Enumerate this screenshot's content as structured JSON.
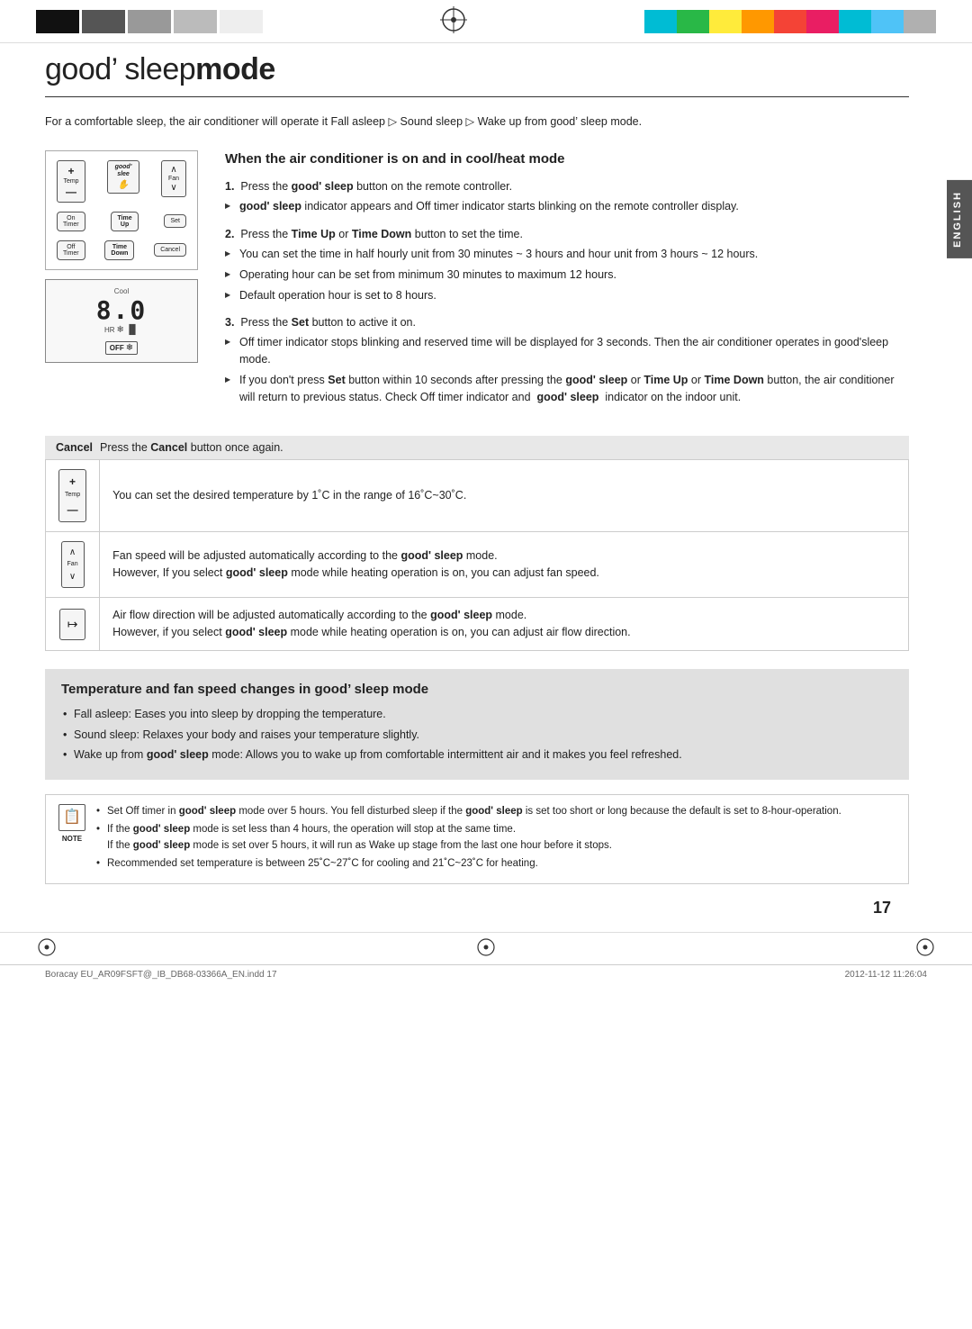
{
  "page": {
    "number": "17",
    "title_prefix": "good’ sleep",
    "title_suffix": "mode"
  },
  "top_bar": {
    "blocks": [
      "#222222",
      "#666666",
      "#999999",
      "#cccccc",
      "#ffffff"
    ],
    "color_swatches": [
      "#00bcd4",
      "#4caf50",
      "#ffeb3b",
      "#ff9800",
      "#f44336",
      "#e91e63",
      "#9c27b0",
      "#2196f3",
      "#00bcd4",
      "#aaaaaa"
    ]
  },
  "intro": "For a comfortable sleep, the air conditioner will operate it Fall asleep ▷ Sound sleep ▷ Wake up from good’ sleep mode.",
  "when_section": {
    "title": "When the air conditioner is on and in cool/heat mode",
    "steps": [
      {
        "number": "1",
        "heading": "Press the good’ sleep button on the remote controller.",
        "bullets": [
          "good’ sleep indicator appears and Off timer indicator starts blinking on the remote controller display."
        ]
      },
      {
        "number": "2",
        "heading": "Press the Time Up or Time Down button to set the time.",
        "bullets": [
          "You can set the time in half hourly unit from 30 minutes ~ 3 hours and hour unit from 3 hours ~ 12 hours.",
          "Operating hour can be set from minimum 30 minutes to maximum 12 hours.",
          "Default operation hour is set to 8 hours."
        ]
      },
      {
        "number": "3",
        "heading": "Press the Set button to active it on.",
        "bullets": [
          "Off timer indicator stops blinking and reserved time will be displayed for 3 seconds. Then the air conditioner operates in good’sleep mode.",
          "If you don’t press Set button within 10 seconds after pressing the good’ sleep or Time Up or Time Down button, the air conditioner will return to previous status. Check Off timer indicator and  good’ sleep  indicator on the indoor unit."
        ]
      }
    ]
  },
  "cancel_box": {
    "label": "Cancel",
    "text": "Press the Cancel button once again."
  },
  "info_table": [
    {
      "icon": "temp-icon",
      "icon_label": "+\nTemp\n—",
      "text": "You can set the desired temperature by 1˚C in the range of 16˚C~30˚C."
    },
    {
      "icon": "fan-icon",
      "icon_label": "∧\nFan\n∨",
      "text": "Fan speed will be adjusted automatically according to the good’ sleep mode.\nHowever, If you select good’ sleep mode while heating operation is on, you can adjust fan speed."
    },
    {
      "icon": "airflow-icon",
      "icon_label": "↦",
      "text": "Air flow direction will be adjusted automatically according to the good’ sleep mode.\nHowever, if you select good’ sleep mode while heating operation is on, you can adjust air flow direction."
    }
  ],
  "temperature_section": {
    "title": "Temperature and fan speed changes in good’ sleep mode",
    "bullets": [
      "Fall asleep: Eases you into sleep by dropping the temperature.",
      "Sound sleep: Relaxes your body and raises your temperature slightly.",
      "Wake up from good’ sleep mode: Allows you to wake up from comfortable intermittent air and it makes you feel refreshed."
    ]
  },
  "note_section": {
    "note_label": "NOTE",
    "bullets": [
      "Set Off timer in good’ sleep mode over 5 hours. You fell disturbed sleep if the good’ sleep is set too short or long because the default is set to 8-hour-operation.",
      "If the good’ sleep mode is set less than 4 hours, the operation will stop at the same time.\nIf the good’ sleep mode is set over 5 hours, it will run as Wake up stage from the last one hour before it stops.",
      "Recommended set temperature is between 25˚C~27˚C for cooling and 21˚C~23˚C for heating."
    ]
  },
  "sidebar": {
    "language": "ENGLISH"
  },
  "footer": {
    "left": "Boracay EU_AR09FSFT@_IB_DB68-03366A_EN.indd   17",
    "right": "2012-11-12  11:26:04"
  },
  "remote": {
    "temp_label": "Temp",
    "fan_label": "Fan",
    "good_sleep": "good'\nslee",
    "on_timer": "On\nTimer",
    "time_up": "Time\nUp",
    "set": "Set",
    "off_timer": "Off\nTimer",
    "time_down": "Time\nDown",
    "cancel": "Cancel",
    "display_mode": "Cool",
    "display_value": "8.0",
    "display_hr": "HR",
    "display_off": "OFF"
  }
}
